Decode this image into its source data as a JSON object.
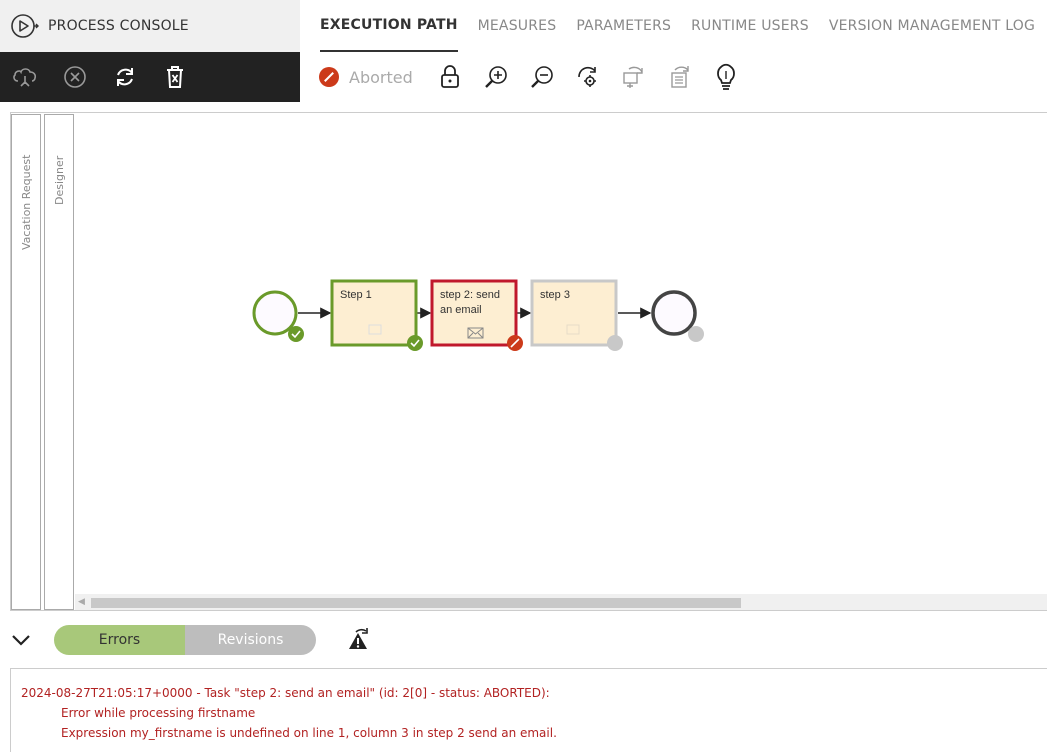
{
  "app": {
    "title": "PROCESS CONSOLE"
  },
  "left_toolbar": {
    "icons": [
      "cloud-network-icon",
      "cancel-circle-icon",
      "refresh-icon",
      "delete-bin-icon"
    ]
  },
  "tabs": [
    {
      "label": "EXECUTION PATH",
      "active": true
    },
    {
      "label": "MEASURES",
      "active": false
    },
    {
      "label": "PARAMETERS",
      "active": false
    },
    {
      "label": "RUNTIME USERS",
      "active": false
    },
    {
      "label": "VERSION MANAGEMENT LOG",
      "active": false
    }
  ],
  "toolbar": {
    "status_label": "Aborted",
    "status_color": "#cc3a1a",
    "icons": [
      "lock-icon",
      "zoom-in-icon",
      "zoom-out-icon",
      "process-settings-icon",
      "reassign-icon",
      "redirect-icon",
      "hint-bulb-icon"
    ]
  },
  "lanes": {
    "lane1": "Vacation Request",
    "lane2": "Designer"
  },
  "diagram": {
    "tasks": [
      {
        "name": "Step 1",
        "state": "completed"
      },
      {
        "name_line1": "step 2: send",
        "name_line2": "an email",
        "state": "aborted"
      },
      {
        "name": "step 3",
        "state": "pending"
      }
    ],
    "colors": {
      "completed": "#6a9a2a",
      "aborted": "#c0182c",
      "pending": "#c8c8c8",
      "task_fill": "#fdeed2"
    }
  },
  "bottom": {
    "tab_errors": "Errors",
    "tab_revisions": "Revisions"
  },
  "log": {
    "line1": "2024-08-27T21:05:17+0000 - Task \"step 2: send an email\" (id: 2[0] - status: ABORTED):",
    "line2": "Error while processing firstname",
    "line3": "Expression my_firstname is undefined on line 1, column 3 in step 2 send an email."
  }
}
